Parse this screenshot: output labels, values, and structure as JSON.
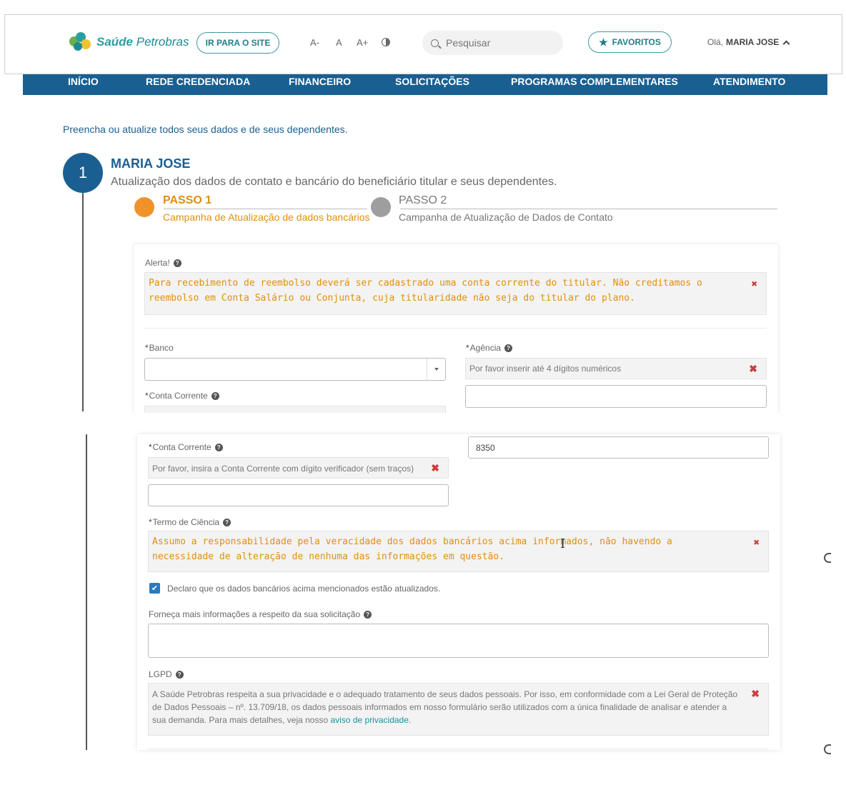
{
  "header": {
    "logo": {
      "brand_bold": "Saúde",
      "brand_light": " Petrobras"
    },
    "site_button": "IR PARA O SITE",
    "font_controls": [
      "A-",
      "A",
      "A+"
    ],
    "search_placeholder": "Pesquisar",
    "favorites_button": "FAVORITOS",
    "greeting": "Olá,",
    "user_name": "MARIA JOSE"
  },
  "nav": [
    "INÍCIO",
    "REDE CREDENCIADA",
    "FINANCEIRO",
    "SOLICITAÇÕES",
    "PROGRAMAS COMPLEMENTARES",
    "ATENDIMENTO"
  ],
  "intro": "Preencha ou atualize todos seus dados e de seus dependentes.",
  "step": {
    "number": "1",
    "name": "MARIA JOSE",
    "subtitle": "Atualização dos dados de contato e bancário do beneficiário titular e seus dependentes."
  },
  "progress": [
    {
      "title": "PASSO 1",
      "desc": "Campanha de Atualização de dados bancários",
      "color": "#f0922a"
    },
    {
      "title": "PASSO 2",
      "desc": "Campanha de Atualização de Dados de Contato",
      "color": "#9e9e9e"
    }
  ],
  "form": {
    "alert_label": "Alerta!",
    "alert_text": "Para recebimento de reembolso deverá ser cadastrado uma conta corrente do titular. Não creditamos o reembolso em Conta Salário ou Conjunta, cuja titularidade não seja do titular do plano.",
    "required_mark": "*",
    "bank_label": "Banco",
    "bank_value": "",
    "agency_label": "Agência",
    "agency_hint": "Por favor inserir até 4 dígitos numéricos",
    "agency_value": "8350",
    "account_label": "Conta Corrente",
    "account_hint": "Por favor, insira a Conta Corrente com dígito verificador (sem traços)",
    "account_value": "",
    "terms_label": "Termo de Ciência",
    "terms_text": "Assumo a responsabilidade pela veracidade dos dados bancários acima informados, não havendo a necessidade de alteração de nenhuma das informações em questão.",
    "checkbox_label": "Declaro que os dados bancários acima mencionados estão atualizados.",
    "checkbox_checked": true,
    "more_info_label": "Forneça mais informações a respeito da sua solicitação",
    "lgpd_label": "LGPD",
    "lgpd_text": "A Saúde Petrobras respeita a sua privacidade e o adequado tratamento de seus dados pessoais. Por isso, em conformidade com a Lei Geral de Proteção de Dados Pessoais – nº. 13.709/18, os dados pessoais informados em nosso formulário serão utilizados com a única finalidade de analisar e atender a sua demanda. Para mais detalhes, veja nosso ",
    "lgpd_link": "aviso de privacidade",
    "lgpd_end": "."
  },
  "icons": {
    "help": "?",
    "close": "✖",
    "star": "★",
    "check": "✔",
    "text_cursor": "I"
  },
  "colors": {
    "primary": "#1a5f91",
    "accent": "#2b9ea3",
    "warning": "#e08f10",
    "error": "#d03b3b"
  }
}
